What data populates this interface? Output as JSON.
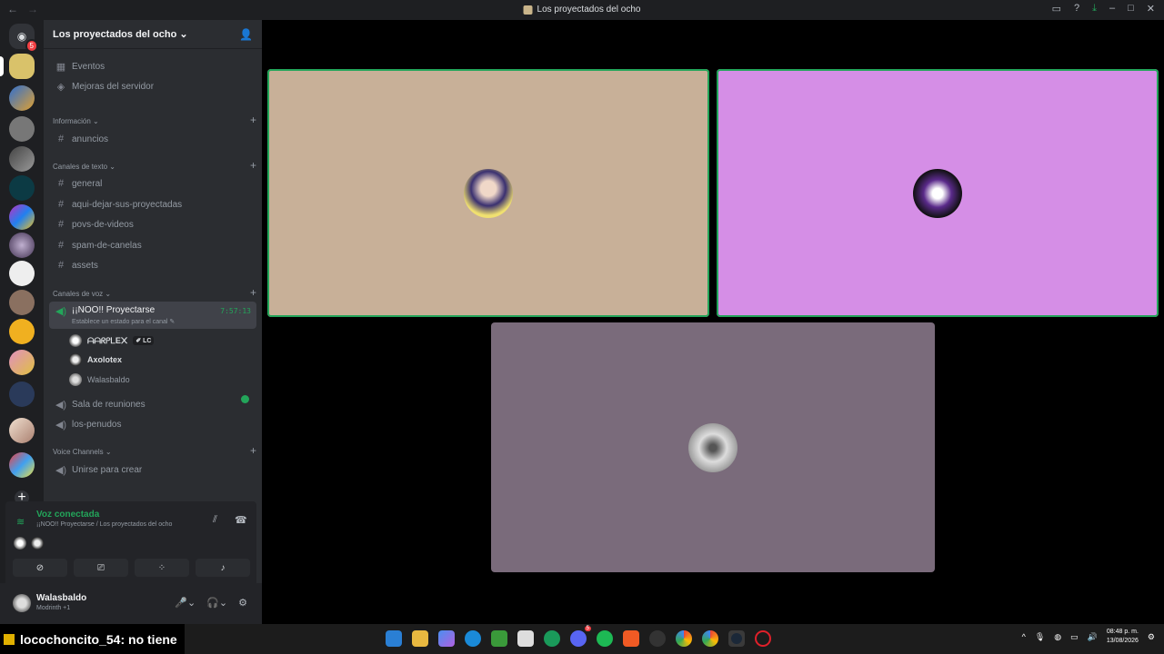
{
  "window": {
    "title": "Los proyectados del ocho"
  },
  "guilds": {
    "home_badge": "5"
  },
  "server": {
    "name": "Los proyectados del ocho"
  },
  "sidebar": {
    "events": "Eventos",
    "boosts": "Mejoras del servidor",
    "cat_info": "Información",
    "cat_text": "Canales de texto",
    "cat_voice": "Canales de voz",
    "cat_voice_channels": "Voice Channels",
    "channels": {
      "anuncios": "anuncios",
      "general": "general",
      "aqui": "aqui-dejar-sus-proyectadas",
      "povs": "povs-de-videos",
      "spam": "spam-de-canelas",
      "assets": "assets"
    },
    "voice_active": {
      "name": "¡¡NOO!! Proyectarse",
      "timer": "7:57:13",
      "status": "Establece un estado para el canal"
    },
    "voice_users": [
      {
        "name": "ᗩᗩᖇᑭᒪE᙭",
        "tag": "✐ LC"
      },
      {
        "name": "Axolotex"
      },
      {
        "name": "Walasbaldo"
      }
    ],
    "sala": "Sala de reuniones",
    "penudos": "los-penudos",
    "unirse": "Unirse para crear"
  },
  "voice_panel": {
    "title": "Voz conectada",
    "subtitle": "¡¡NOO!! Proyectarse / Los proyectados del ocho"
  },
  "user_panel": {
    "name": "Walasbaldo",
    "sub": "Modrinth +1"
  },
  "stage": {
    "colors": {
      "tile1": "#c8b098",
      "tile2": "#d58ee6",
      "tile3": "#7a6b7b",
      "speaking": "#23a55a"
    }
  },
  "taskbar": {
    "overlay": "locochoncito_54",
    "overlay_suffix": " : no tiene",
    "discord_badge": "5",
    "time": "08:48 p. m.",
    "date": "13/08/2026"
  }
}
